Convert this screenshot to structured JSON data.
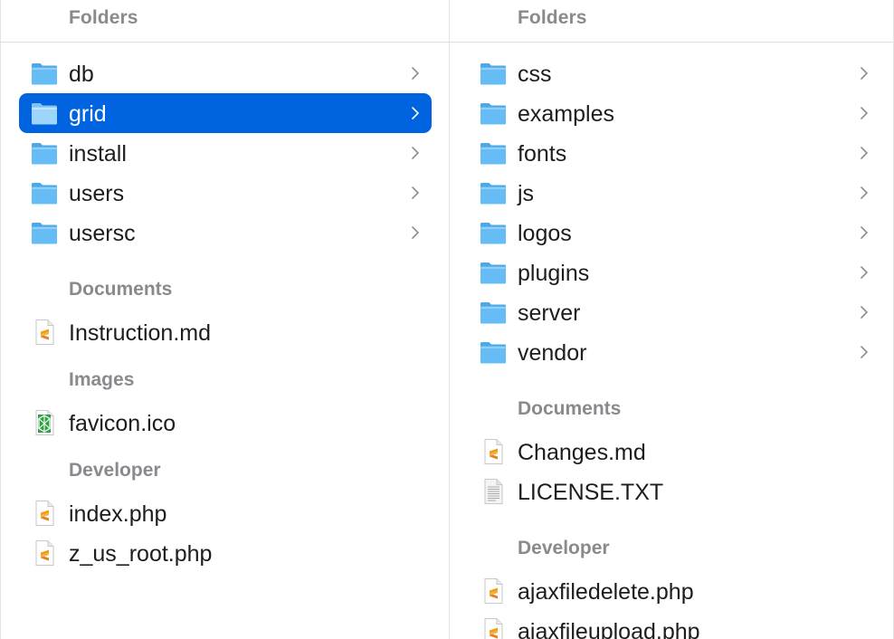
{
  "left_column": {
    "header": "Folders",
    "folders": [
      {
        "label": "db",
        "selected": false
      },
      {
        "label": "grid",
        "selected": true
      },
      {
        "label": "install",
        "selected": false
      },
      {
        "label": "users",
        "selected": false
      },
      {
        "label": "usersc",
        "selected": false
      }
    ],
    "documents_label": "Documents",
    "documents": [
      {
        "label": "Instruction.md",
        "icon": "markdown-file-icon"
      }
    ],
    "images_label": "Images",
    "images": [
      {
        "label": "favicon.ico",
        "icon": "ico-file-icon"
      }
    ],
    "developer_label": "Developer",
    "developer": [
      {
        "label": "index.php",
        "icon": "php-file-icon"
      },
      {
        "label": "z_us_root.php",
        "icon": "php-file-icon"
      }
    ]
  },
  "right_column": {
    "header": "Folders",
    "folders": [
      {
        "label": "css"
      },
      {
        "label": "examples"
      },
      {
        "label": "fonts"
      },
      {
        "label": "js"
      },
      {
        "label": "logos"
      },
      {
        "label": "plugins"
      },
      {
        "label": "server"
      },
      {
        "label": "vendor"
      }
    ],
    "documents_label": "Documents",
    "documents": [
      {
        "label": "Changes.md",
        "icon": "markdown-file-icon"
      },
      {
        "label": "LICENSE.TXT",
        "icon": "text-file-icon"
      }
    ],
    "developer_label": "Developer",
    "developer": [
      {
        "label": "ajaxfiledelete.php",
        "icon": "php-file-icon"
      },
      {
        "label": "ajaxfileupload.php",
        "icon": "php-file-icon"
      }
    ]
  },
  "colors": {
    "selection": "#0064e1",
    "folder_blue": "#5ab4f0",
    "section_gray": "#8a8a8e"
  }
}
